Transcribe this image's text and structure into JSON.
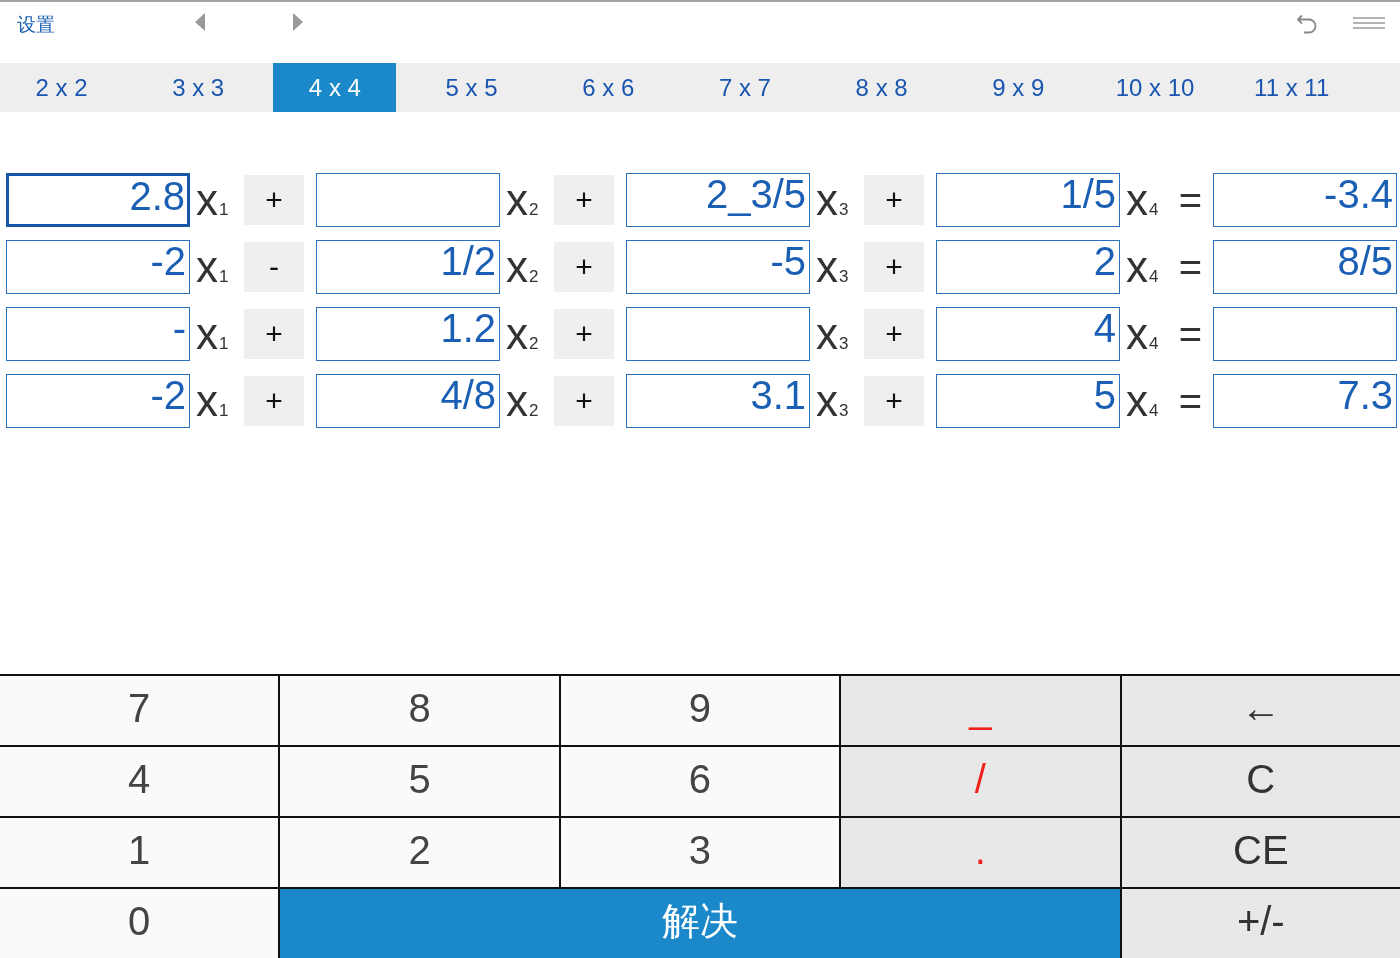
{
  "header": {
    "settings": "设置"
  },
  "tabs": [
    {
      "label": "2 x 2",
      "selected": false
    },
    {
      "label": "3 x 3",
      "selected": false
    },
    {
      "label": "4 x 4",
      "selected": true
    },
    {
      "label": "5 x 5",
      "selected": false
    },
    {
      "label": "6 x 6",
      "selected": false
    },
    {
      "label": "7 x 7",
      "selected": false
    },
    {
      "label": "8 x 8",
      "selected": false
    },
    {
      "label": "9 x 9",
      "selected": false
    },
    {
      "label": "10 x 10",
      "selected": false
    },
    {
      "label": "11 x 11",
      "selected": false
    }
  ],
  "equations": [
    {
      "terms": [
        {
          "value": "2.8",
          "focused": true,
          "variable": "x$_{1}$",
          "operator": "+"
        },
        {
          "focused": false,
          "variable": "x$_{2}$",
          "operator": "+"
        },
        {
          "value": "2_3/5",
          "focused": false,
          "variable": "x$_{3}$",
          "operator": "+"
        },
        {
          "value": "1/5",
          "focused": false,
          "variable": "x$_{4}$"
        }
      ],
      "equals": "=",
      "result": {
        "value": "-3.4",
        "focused": false
      }
    },
    {
      "terms": [
        {
          "value": "-2",
          "focused": false,
          "variable": "x$_{1}$",
          "operator": "-"
        },
        {
          "value": "1/2",
          "focused": false,
          "variable": "x$_{2}$",
          "operator": "+"
        },
        {
          "value": "-5",
          "focused": false,
          "variable": "x$_{3}$",
          "operator": "+"
        },
        {
          "value": "2",
          "focused": false,
          "variable": "x$_{4}$"
        }
      ],
      "equals": "=",
      "result": {
        "value": "8/5",
        "focused": false
      }
    },
    {
      "terms": [
        {
          "value": "-",
          "focused": false,
          "variable": "x$_{1}$",
          "operator": "+"
        },
        {
          "value": "1.2",
          "focused": false,
          "variable": "x$_{2}$",
          "operator": "+"
        },
        {
          "focused": false,
          "variable": "x$_{3}$",
          "operator": "+"
        },
        {
          "value": "4",
          "focused": false,
          "variable": "x$_{4}$"
        }
      ],
      "equals": "=",
      "result": {
        "focused": false
      }
    },
    {
      "terms": [
        {
          "value": "-2",
          "focused": false,
          "variable": "x$_{1}$",
          "operator": "+"
        },
        {
          "value": "4/8",
          "focused": false,
          "variable": "x$_{2}$",
          "operator": "+"
        },
        {
          "value": "3.1",
          "focused": false,
          "variable": "x$_{3}$",
          "operator": "+"
        },
        {
          "value": "5",
          "focused": false,
          "variable": "x$_{4}$"
        }
      ],
      "equals": "=",
      "result": {
        "value": "7.3",
        "focused": false
      }
    }
  ],
  "keypad": [
    {
      "label": "7",
      "kind": "digit"
    },
    {
      "label": "8",
      "kind": "digit"
    },
    {
      "label": "9",
      "kind": "digit"
    },
    {
      "label": "_",
      "kind": "symbol"
    },
    {
      "label": "←",
      "kind": "function"
    },
    {
      "label": "4",
      "kind": "digit"
    },
    {
      "label": "5",
      "kind": "digit"
    },
    {
      "label": "6",
      "kind": "digit"
    },
    {
      "label": "/",
      "kind": "symbol"
    },
    {
      "label": "C",
      "kind": "function"
    },
    {
      "label": "1",
      "kind": "digit"
    },
    {
      "label": "2",
      "kind": "digit"
    },
    {
      "label": "3",
      "kind": "digit"
    },
    {
      "label": ".",
      "kind": "symbol"
    },
    {
      "label": "CE",
      "kind": "function"
    },
    {
      "label": "0",
      "kind": "digit"
    },
    {
      "label": "解决",
      "kind": "solve"
    },
    {
      "label": "+/-",
      "kind": "function"
    }
  ]
}
